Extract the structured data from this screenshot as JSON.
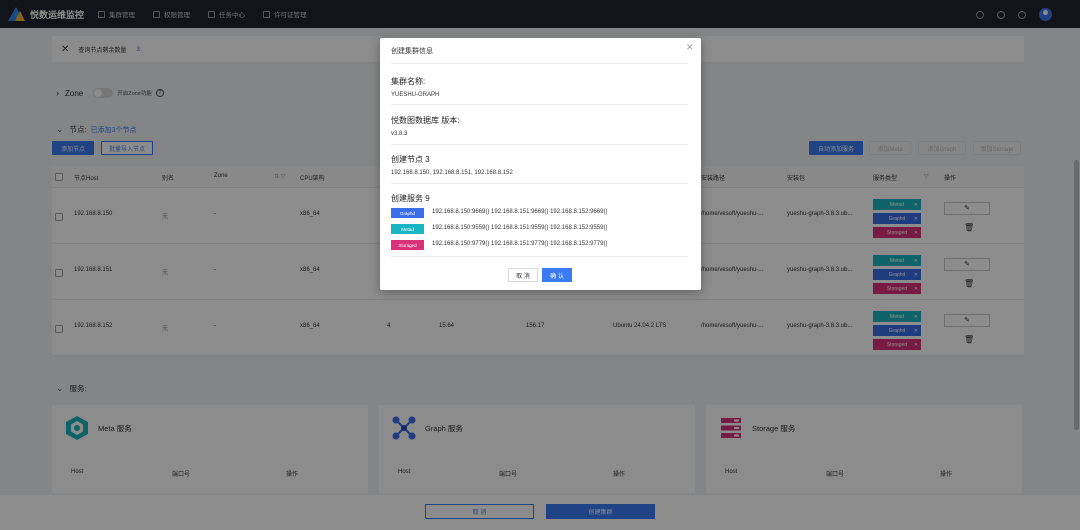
{
  "app": {
    "title": "悦数运维监控"
  },
  "nav": [
    {
      "label": "集群管理",
      "icon": "cluster-icon"
    },
    {
      "label": "权限管理",
      "icon": "users-icon"
    },
    {
      "label": "任务中心",
      "icon": "task-icon"
    },
    {
      "label": "许可证管理",
      "icon": "license-icon"
    }
  ],
  "infobar": {
    "text": "查询节点剩余数量",
    "count": "3"
  },
  "zone": {
    "label": "Zone",
    "hint": "开启Zone功能",
    "enabled": false
  },
  "nodes": {
    "label": "节点:",
    "count_text": "已添加3个节点",
    "buttons": {
      "add": "添加节点",
      "batch_import": "批量导入节点",
      "auto_add": "自动添加服务",
      "add_meta": "添加Meta",
      "add_graph": "添加Graph",
      "add_storage": "添加Storage"
    },
    "columns": [
      "节点Host",
      "别名",
      "Zone",
      "CPU架构",
      "安装路径",
      "安装包",
      "服务类型",
      "操作"
    ],
    "rows": [
      {
        "host": "192.168.8.150",
        "alias": "无",
        "zone": "-",
        "cpu": "x86_64",
        "path": "/home/vesoft/yueshu-...",
        "pkg": "yueshu-graph-3.8.3.ub...",
        "services": [
          "Metad",
          "Graphd",
          "Storaged"
        ]
      },
      {
        "host": "192.168.8.151",
        "alias": "无",
        "zone": "-",
        "cpu": "x86_64",
        "path": "/home/vesoft/yueshu-...",
        "pkg": "yueshu-graph-3.8.3.ub...",
        "services": [
          "Metad",
          "Graphd",
          "Storaged"
        ]
      },
      {
        "host": "192.168.8.152",
        "alias": "无",
        "zone": "-",
        "cpu": "x86_64",
        "cores": "4",
        "mem": "15.64",
        "disk": "156.17",
        "os": "Ubuntu 24.04.2 LTS",
        "path": "/home/vesoft/yueshu-...",
        "pkg": "yueshu-graph-3.8.3.ub...",
        "services": [
          "Metad",
          "Graphd",
          "Storaged"
        ]
      }
    ]
  },
  "services": {
    "label": "服务:",
    "cards": [
      {
        "title": "Meta 服务",
        "cols": [
          "Host",
          "端口号",
          "操作"
        ]
      },
      {
        "title": "Graph 服务",
        "cols": [
          "Host",
          "端口号",
          "操作"
        ]
      },
      {
        "title": "Storage 服务",
        "cols": [
          "Host",
          "端口号",
          "操作"
        ]
      }
    ]
  },
  "footer": {
    "cancel": "取 消",
    "create": "创建集群"
  },
  "modal": {
    "title": "创建集群信息",
    "cluster_name_label": "集群名称:",
    "cluster_name": "YUESHU-GRAPH",
    "version_label": "悦数图数据库 版本:",
    "version": "v3.8.3",
    "nodes_label": "创建节点 3",
    "nodes_value": "192.168.8.150, 192.168.8.151, 192.168.8.152",
    "services_label": "创建服务 9",
    "services": [
      {
        "type": "Graphd",
        "color": "#3a6ee8",
        "addrs": "192.168.8.150:9669()   192.168.8.151:9669()   192.168.8.152:9669()"
      },
      {
        "type": "Metad",
        "color": "#1ab5c4",
        "addrs": "192.168.8.150:9559()   192.168.8.151:9559()   192.168.8.152:9559()"
      },
      {
        "type": "Storaged",
        "color": "#d9327a",
        "addrs": "192.168.8.150:9779()   192.168.8.151:9779()   192.168.8.152:9779()"
      }
    ],
    "cancel": "取 消",
    "ok": "确 认"
  }
}
